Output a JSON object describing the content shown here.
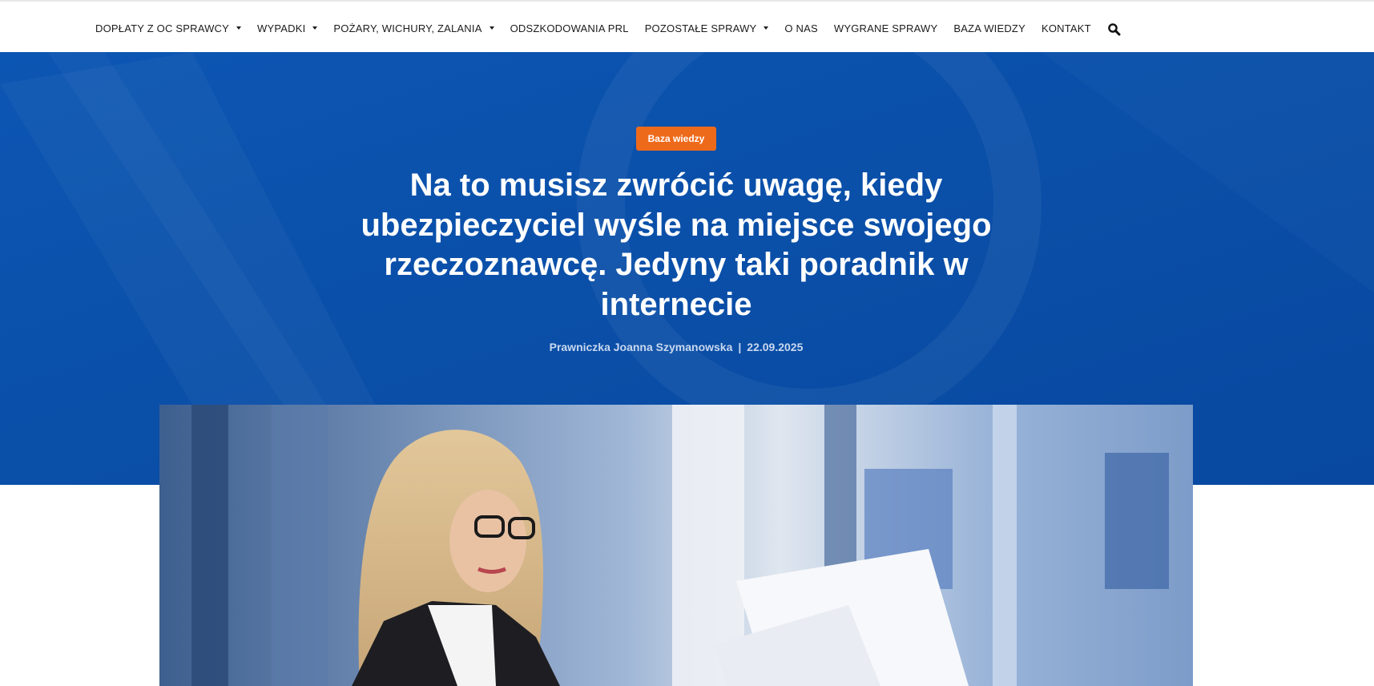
{
  "nav": {
    "items": [
      {
        "label": "DOPŁATY Z OC SPRAWCY",
        "has_dropdown": true
      },
      {
        "label": "WYPADKI",
        "has_dropdown": true
      },
      {
        "label": "POŻARY, WICHURY, ZALANIA",
        "has_dropdown": true
      },
      {
        "label": "ODSZKODOWANIA PRL",
        "has_dropdown": false
      },
      {
        "label": "POZOSTAŁE SPRAWY",
        "has_dropdown": true
      },
      {
        "label": "O NAS",
        "has_dropdown": false
      },
      {
        "label": "WYGRANE SPRAWY",
        "has_dropdown": false
      },
      {
        "label": "BAZA WIEDZY",
        "has_dropdown": false
      },
      {
        "label": "KONTAKT",
        "has_dropdown": false
      }
    ],
    "search_icon": "search-icon"
  },
  "hero": {
    "category": "Baza wiedzy",
    "title": "Na to musisz zwrócić uwagę, kiedy ubezpieczyciel wyśle na miejsce swojego rzeczoznawcę. Jedyny taki poradnik w internecie",
    "author": "Prawniczka Joanna Szymanowska",
    "separator": "|",
    "date": "22.09.2025"
  },
  "colors": {
    "hero_bg": "#0a4fa8",
    "badge_bg": "#ee6a1b",
    "meta_text": "#c9d8ef"
  }
}
